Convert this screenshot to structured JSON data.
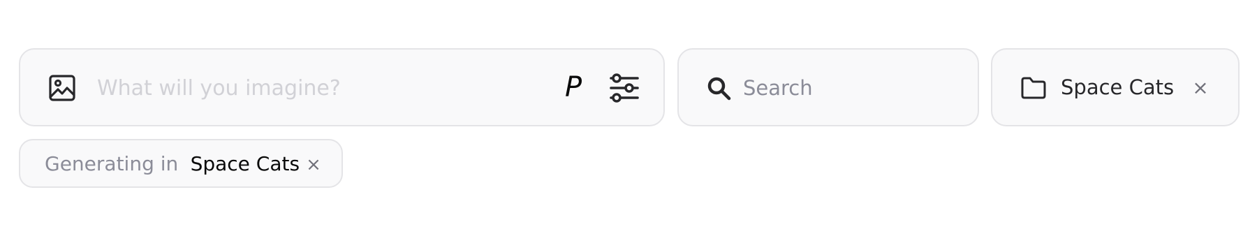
{
  "prompt_bar": {
    "placeholder": "What will you imagine?",
    "value": "",
    "style_button_label": "P",
    "image_icon": "image-icon",
    "settings_icon": "sliders-icon"
  },
  "search": {
    "placeholder": "Search",
    "value": "",
    "icon": "search-icon"
  },
  "folder_chip": {
    "icon": "folder-icon",
    "label": "Space Cats",
    "close_label": "×"
  },
  "generating_chip": {
    "prefix": "Generating in",
    "folder": "Space Cats",
    "close_label": "×"
  },
  "colors": {
    "box_background": "#f9f9fa",
    "box_border": "#e4e4e7",
    "placeholder_light": "#d1d1d6",
    "placeholder_muted": "#8b8c98",
    "icon": "#27272a"
  }
}
